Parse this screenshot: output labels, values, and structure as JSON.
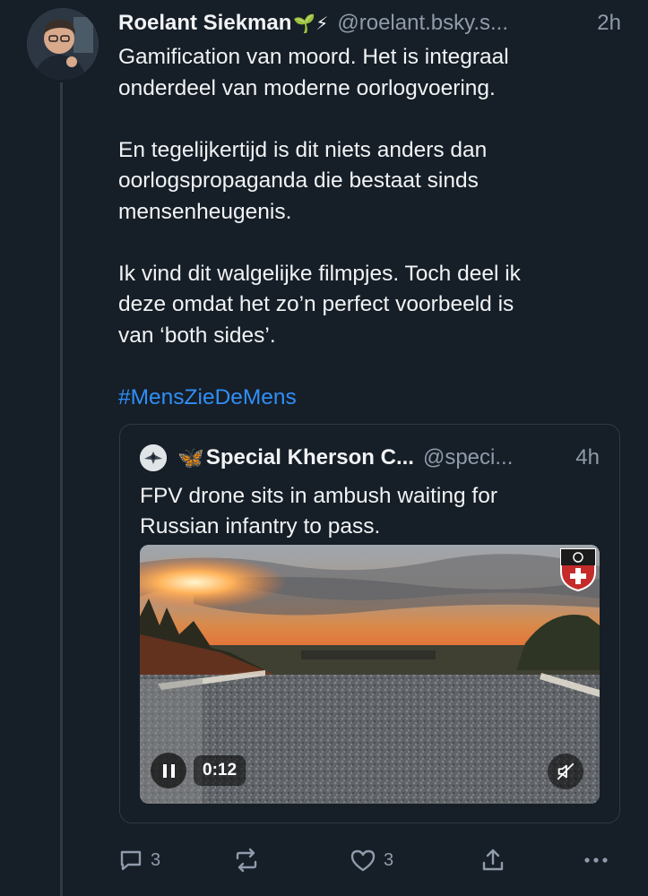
{
  "post": {
    "author_name": "Roelant Siekman",
    "author_emojis": "🌱⚡",
    "handle": "@roelant.bsky.s...",
    "time": "2h",
    "paragraphs": [
      [
        "Gamification van moord. Het is integraal",
        "onderdeel van moderne oorlogvoering."
      ],
      [
        "En tegelijkertijd is dit niets anders dan",
        "oorlogspropaganda die bestaat sinds",
        "mensenheugenis."
      ],
      [
        "Ik vind dit walgelijke filmpjes. Toch deel ik",
        "deze omdat het zo’n perfect voorbeeld is",
        "van ‘both sides’."
      ]
    ],
    "hashtag": "#MensZieDeMens"
  },
  "quote": {
    "author_icon": "🦋",
    "author_name": "Special Kherson C...",
    "handle": "@speci...",
    "time": "4h",
    "text_lines": [
      "FPV drone sits in ambush waiting for",
      "Russian infantry to pass."
    ],
    "video": {
      "timecode": "0:12"
    }
  },
  "actions": {
    "reply_count": "3",
    "like_count": "3"
  },
  "colors": {
    "background": "#161e27",
    "accent": "#2f8ff8",
    "muted": "#8f9bab"
  },
  "icons": [
    "reply-icon",
    "repost-icon",
    "like-icon",
    "share-icon",
    "more-icon",
    "pause-icon",
    "mute-icon"
  ]
}
